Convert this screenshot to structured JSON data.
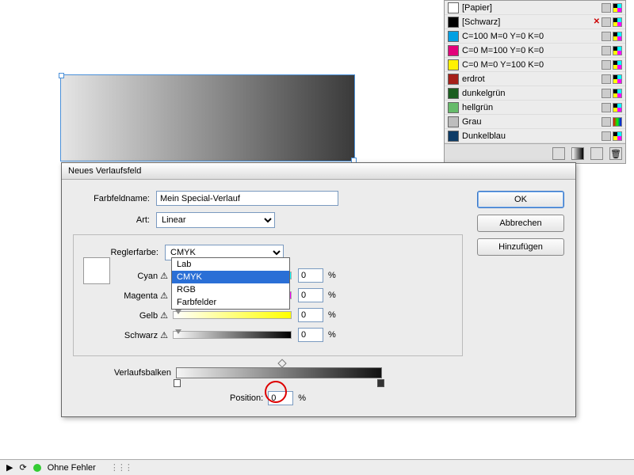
{
  "swatches": {
    "items": [
      {
        "name": "[Papier]",
        "color": "#ffffff"
      },
      {
        "name": "[Schwarz]",
        "color": "#000000"
      },
      {
        "name": "C=100 M=0 Y=0 K=0",
        "color": "#00a0e3"
      },
      {
        "name": "C=0 M=100 Y=0 K=0",
        "color": "#e3007b"
      },
      {
        "name": "C=0 M=0 Y=100 K=0",
        "color": "#fff200"
      },
      {
        "name": "erdrot",
        "color": "#a52019"
      },
      {
        "name": "dunkelgrün",
        "color": "#1b5e20"
      },
      {
        "name": "hellgrün",
        "color": "#66bb6a"
      },
      {
        "name": "Grau",
        "color": "#bdbdbd"
      },
      {
        "name": "Dunkelblau",
        "color": "#0d3b66"
      }
    ]
  },
  "dialog": {
    "title": "Neues Verlaufsfeld",
    "name_label": "Farbfeldname:",
    "name_value": "Mein Special-Verlauf",
    "type_label": "Art:",
    "type_value": "Linear",
    "stopcolor_label": "Reglerfarbe:",
    "stopcolor_value": "CMYK",
    "dropdown_options": [
      "Lab",
      "CMYK",
      "RGB",
      "Farbfelder"
    ],
    "sliders": {
      "cyan": {
        "label": "Cyan",
        "value": "0"
      },
      "magenta": {
        "label": "Magenta",
        "value": "0"
      },
      "yellow": {
        "label": "Gelb",
        "value": "0"
      },
      "black": {
        "label": "Schwarz",
        "value": "0"
      }
    },
    "gradient_label": "Verlaufsbalken",
    "position_label": "Position:",
    "position_value": "0",
    "percent": "%",
    "buttons": {
      "ok": "OK",
      "cancel": "Abbrechen",
      "add": "Hinzufügen"
    }
  },
  "status": {
    "text": "Ohne Fehler"
  }
}
